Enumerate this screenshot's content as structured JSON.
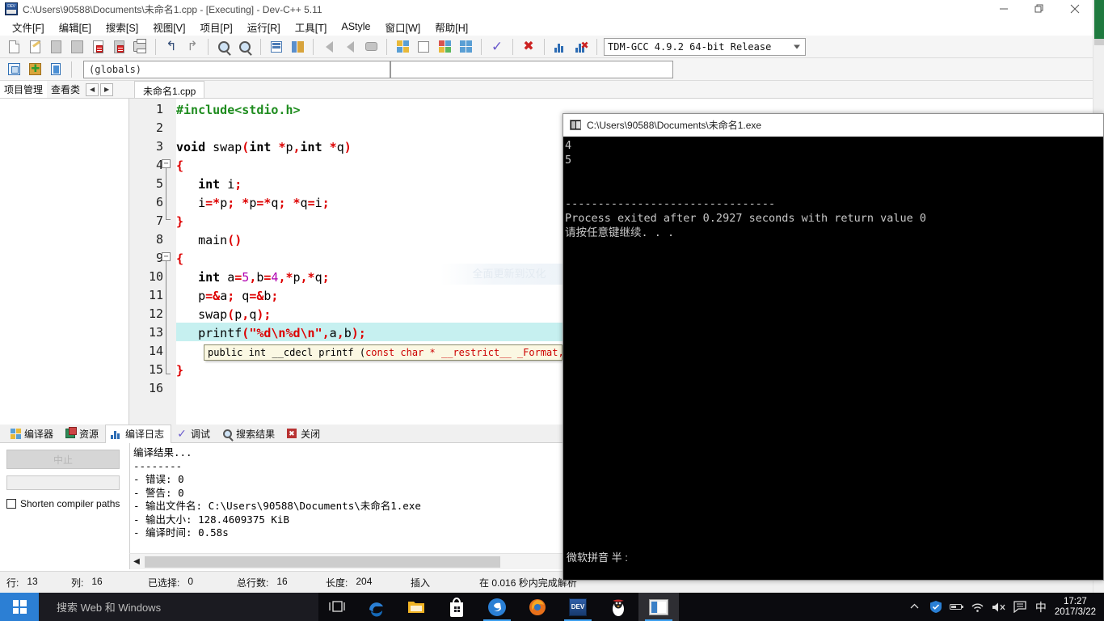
{
  "window": {
    "title": "C:\\Users\\90588\\Documents\\未命名1.cpp - [Executing] - Dev-C++ 5.11",
    "minimize_label": "—",
    "maximize_label": "❐",
    "close_label": "✕"
  },
  "menu": [
    {
      "label": "文件[F]"
    },
    {
      "label": "编辑[E]"
    },
    {
      "label": "搜索[S]"
    },
    {
      "label": "视图[V]"
    },
    {
      "label": "项目[P]"
    },
    {
      "label": "运行[R]"
    },
    {
      "label": "工具[T]"
    },
    {
      "label": "AStyle"
    },
    {
      "label": "窗口[W]"
    },
    {
      "label": "帮助[H]"
    }
  ],
  "toolbar": {
    "compiler_select": "TDM-GCC 4.9.2 64-bit Release",
    "scope_select": "(globals)",
    "icons": [
      "new-file-icon",
      "open-file-icon",
      "save-file-icon",
      "save-all-icon",
      "close-file-icon",
      "close-all-icon",
      "print-icon",
      "undo-icon",
      "redo-icon",
      "find-icon",
      "replace-icon",
      "goto-line-icon",
      "indent-icon",
      "step-back-icon",
      "step-forward-icon",
      "stop-icon",
      "compile-icon",
      "run-icon",
      "compile-run-icon",
      "rebuild-icon",
      "syntax-check-icon",
      "delete-icon",
      "profile-icon",
      "debug-icon"
    ]
  },
  "left_panel": {
    "tabs": [
      {
        "label": "项目管理",
        "active": true
      },
      {
        "label": "查看类",
        "active": false
      }
    ],
    "nav_prev": "◀",
    "nav_next": "▶"
  },
  "editor": {
    "tab_label": "未命名1.cpp",
    "watermark": "全面更新到汉化",
    "highlighted_line": 13,
    "tooltip": {
      "prefix": "public int __cdecl printf (",
      "red": "const char * __restrict__ _Format,",
      "suffix": " ."
    },
    "lines": [
      {
        "n": 1,
        "text": "#include<stdio.h>"
      },
      {
        "n": 2,
        "text": ""
      },
      {
        "n": 3,
        "text": "void swap(int *p,int *q)"
      },
      {
        "n": 4,
        "text": "{"
      },
      {
        "n": 5,
        "text": "    int i;"
      },
      {
        "n": 6,
        "text": "    i=*p; *p=*q; *q=i;"
      },
      {
        "n": 7,
        "text": "}"
      },
      {
        "n": 8,
        "text": "    main()"
      },
      {
        "n": 9,
        "text": "{"
      },
      {
        "n": 10,
        "text": "    int a=5,b=4,*p,*q;"
      },
      {
        "n": 11,
        "text": "    p=&a; q=&b;"
      },
      {
        "n": 12,
        "text": "    swap(p,q);"
      },
      {
        "n": 13,
        "text": "    printf(\"%d\\n%d\\n\",a,b);"
      },
      {
        "n": 14,
        "text": ""
      },
      {
        "n": 15,
        "text": "}"
      },
      {
        "n": 16,
        "text": ""
      }
    ]
  },
  "bottom_tabs": [
    {
      "label": "编译器",
      "icon": "compiler-icon",
      "active": false
    },
    {
      "label": "资源",
      "icon": "resources-icon",
      "active": false
    },
    {
      "label": "编译日志",
      "icon": "compile-log-icon",
      "active": true
    },
    {
      "label": "调试",
      "icon": "debug-check-icon",
      "active": false
    },
    {
      "label": "搜索结果",
      "icon": "search-results-icon",
      "active": false
    },
    {
      "label": "关闭",
      "icon": "close-panel-icon",
      "active": false
    }
  ],
  "compile_panel": {
    "abort_button": "中止",
    "shorten_paths_label": "Shorten compiler paths",
    "shorten_paths_checked": false,
    "log": [
      "编译结果...",
      "--------",
      "- 错误: 0",
      "- 警告: 0",
      "- 输出文件名: C:\\Users\\90588\\Documents\\未命名1.exe",
      "- 输出大小: 128.4609375 KiB",
      "- 编译时间: 0.58s"
    ]
  },
  "statusbar": {
    "row_label": "行:",
    "row_value": "13",
    "col_label": "列:",
    "col_value": "16",
    "sel_label": "已选择:",
    "sel_value": "0",
    "total_label": "总行数:",
    "total_value": "16",
    "len_label": "长度:",
    "len_value": "204",
    "mode": "插入",
    "parse": "在 0.016 秒内完成解析"
  },
  "console": {
    "title": "C:\\Users\\90588\\Documents\\未命名1.exe",
    "lines": [
      "4",
      "5",
      "",
      "",
      "--------------------------------",
      "Process exited after 0.2927 seconds with return value 0",
      "请按任意键继续. . ."
    ],
    "ime_status": "微软拼音 半 :"
  },
  "taskbar": {
    "start_label": "start-button",
    "search_placeholder": "搜索 Web 和 Windows",
    "task_view": "task-view-icon",
    "apps": [
      {
        "name": "edge-icon",
        "running": false,
        "active": false
      },
      {
        "name": "explorer-icon",
        "running": false,
        "active": false
      },
      {
        "name": "store-icon",
        "running": false,
        "active": false
      },
      {
        "name": "sogou-icon",
        "running": true,
        "active": false
      },
      {
        "name": "firefox-icon",
        "running": false,
        "active": false
      },
      {
        "name": "devcpp-icon",
        "running": true,
        "active": false
      },
      {
        "name": "penguin-icon",
        "running": false,
        "active": false
      },
      {
        "name": "devcpp-window-icon",
        "running": true,
        "active": true
      }
    ],
    "tray": [
      {
        "name": "show-hidden-icons",
        "glyph": "⌃"
      },
      {
        "name": "security-shield-icon",
        "glyph": "🛡"
      },
      {
        "name": "battery-icon",
        "glyph": "▭"
      },
      {
        "name": "wifi-icon",
        "glyph": "📶"
      },
      {
        "name": "volume-mute-icon",
        "glyph": "🔇"
      },
      {
        "name": "action-center-icon",
        "glyph": "🗨"
      },
      {
        "name": "ime-chinese-icon",
        "glyph": "中"
      }
    ],
    "time": "17:27",
    "date": "2017/3/22"
  },
  "colors": {
    "accent": "#2c7fd4",
    "highlight": "#c6f0f0",
    "string": "#dd0000",
    "preprocessor": "#1e8c1e",
    "number": "#b000b0",
    "console_bg": "#000000",
    "taskbar_bg": "#0b0b0f"
  }
}
